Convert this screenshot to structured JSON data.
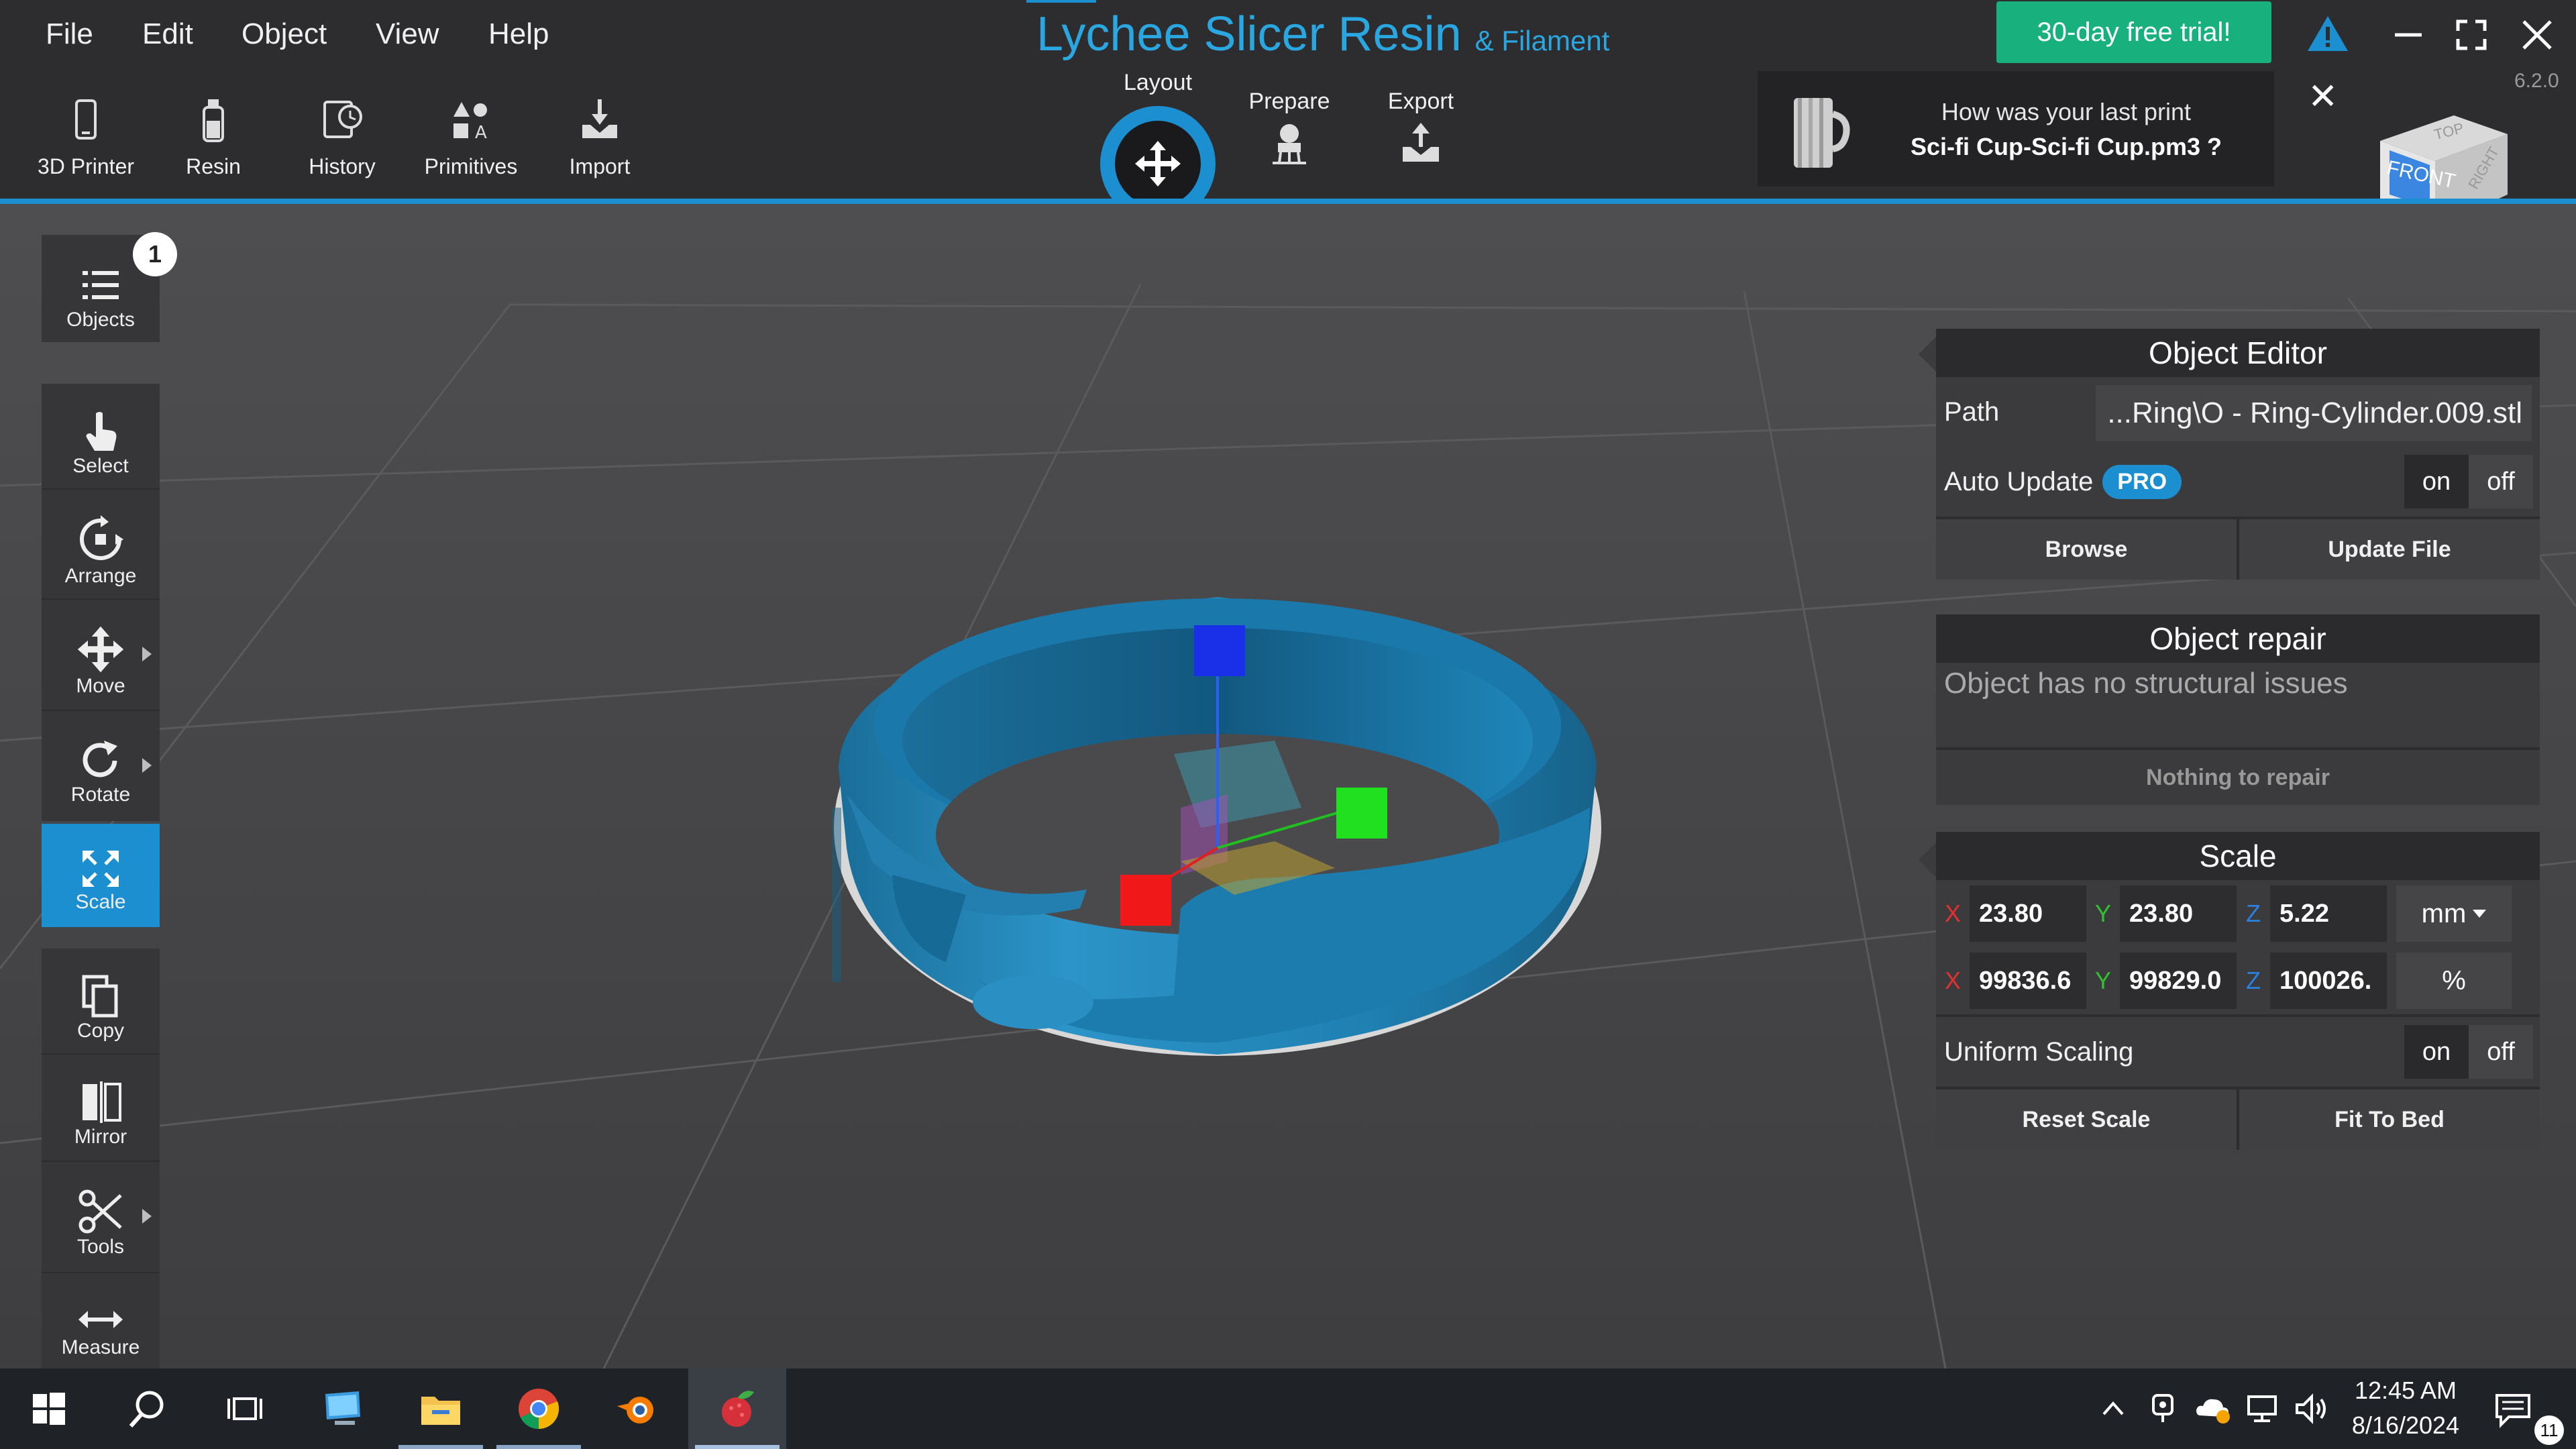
{
  "menu": [
    "File",
    "Edit",
    "Object",
    "View",
    "Help"
  ],
  "app": {
    "title": "Lychee Slicer Resin",
    "subtitle": "& Filament",
    "version": "6.2.0"
  },
  "toolbar": [
    {
      "label": "3D Printer",
      "icon": "phone-icon"
    },
    {
      "label": "Resin",
      "icon": "resin-bottle-icon"
    },
    {
      "label": "History",
      "icon": "history-icon"
    },
    {
      "label": "Primitives",
      "icon": "primitives-icon"
    },
    {
      "label": "Import",
      "icon": "import-icon"
    }
  ],
  "modes": {
    "layout": "Layout",
    "prepare": "Prepare",
    "export": "Export"
  },
  "trial_button": "30-day free trial!",
  "notification": {
    "question": "How was your last print",
    "file": "Sci-fi Cup-Sci-fi Cup.pm3 ?"
  },
  "viewcube": {
    "front": "FRONT",
    "top": "TOP",
    "right": "RIGHT"
  },
  "left_tools": {
    "objects": "Objects",
    "objects_count": "1",
    "select": "Select",
    "arrange": "Arrange",
    "move": "Move",
    "rotate": "Rotate",
    "scale": "Scale",
    "copy": "Copy",
    "mirror": "Mirror",
    "tools": "Tools",
    "measure": "Measure"
  },
  "object_editor": {
    "title": "Object Editor",
    "path_label": "Path",
    "path_value": "...Ring\\O - Ring-Cylinder.009.stl",
    "auto_update_label": "Auto Update",
    "pro_badge": "PRO",
    "on": "on",
    "off": "off",
    "browse": "Browse",
    "update_file": "Update File"
  },
  "object_repair": {
    "title": "Object repair",
    "status": "Object has no structural issues",
    "action": "Nothing to repair"
  },
  "scale": {
    "title": "Scale",
    "axes": {
      "x": "X",
      "y": "Y",
      "z": "Z"
    },
    "mm": {
      "x": "23.80",
      "y": "23.80",
      "z": "5.22",
      "unit": "mm"
    },
    "percent": {
      "x": "99836.6",
      "y": "99829.0",
      "z": "100026.",
      "unit": "%"
    },
    "uniform_label": "Uniform Scaling",
    "on": "on",
    "off": "off",
    "reset": "Reset Scale",
    "fit": "Fit To Bed"
  },
  "taskbar": {
    "time": "12:45 AM",
    "date": "8/16/2024",
    "notifications": "11"
  },
  "colors": {
    "accent": "#1c8fd0",
    "trial": "#18b07d",
    "model": "#1e7fb0"
  }
}
